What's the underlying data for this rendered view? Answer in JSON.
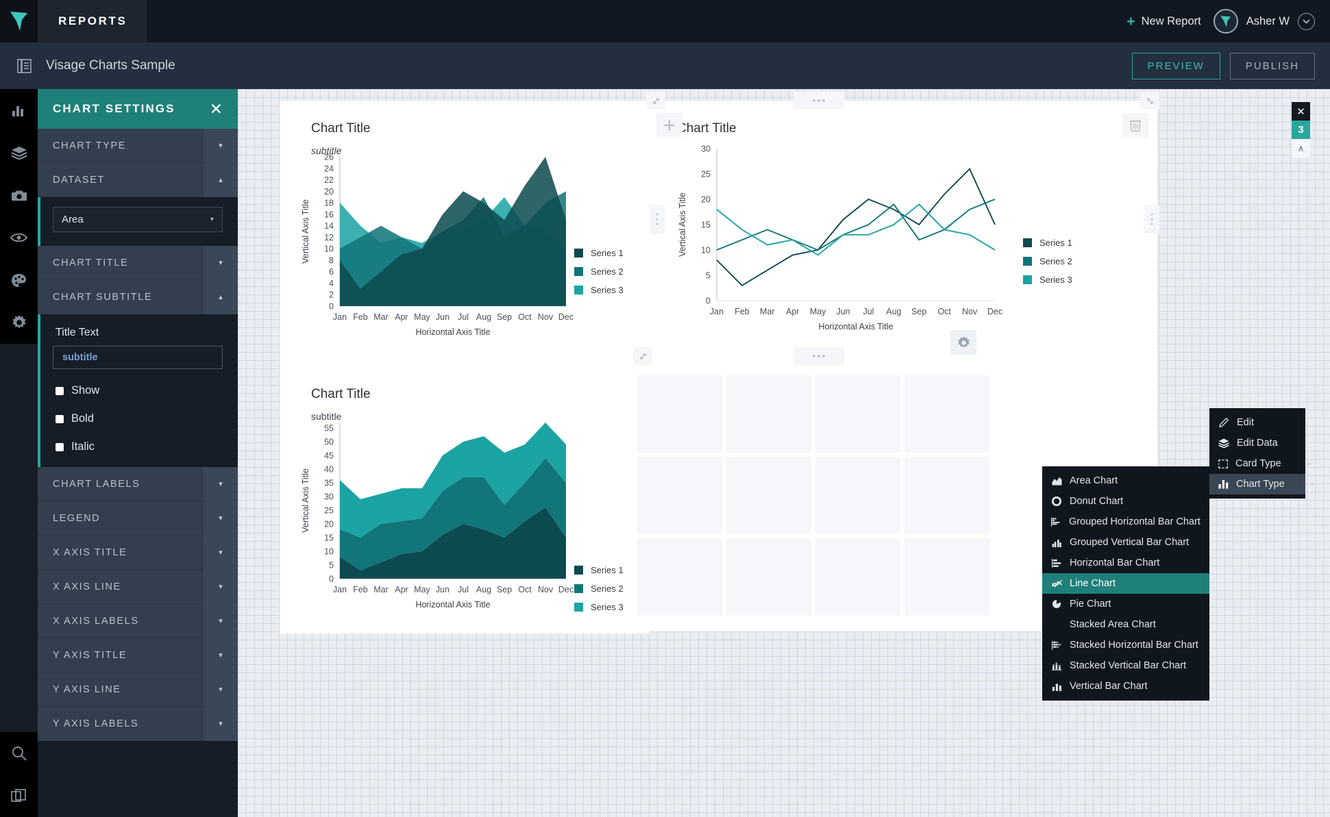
{
  "topbar": {
    "nav_tab": "REPORTS",
    "new_report": "New Report",
    "plus": "+",
    "user_name": "Asher W",
    "chevron": "⌄"
  },
  "subbar": {
    "doc_title": "Visage Charts Sample",
    "preview": "PREVIEW",
    "publish": "PUBLISH"
  },
  "rail": {
    "items": [
      {
        "icon": "bar-chart-icon"
      },
      {
        "icon": "layers-icon"
      },
      {
        "icon": "camera-icon"
      },
      {
        "icon": "eye-icon"
      },
      {
        "icon": "palette-icon"
      },
      {
        "icon": "gear-icon"
      }
    ],
    "bottom": [
      {
        "icon": "search-icon"
      },
      {
        "icon": "copy-icon"
      }
    ]
  },
  "panel": {
    "title": "CHART SETTINGS",
    "close": "✕",
    "sections": [
      {
        "label": "CHART TYPE",
        "open": false
      },
      {
        "label": "DATASET",
        "open": true
      },
      {
        "label": "CHART TITLE",
        "open": false
      },
      {
        "label": "CHART SUBTITLE",
        "open": true
      },
      {
        "label": "CHART LABELS",
        "open": false
      },
      {
        "label": "LEGEND",
        "open": false
      },
      {
        "label": "X AXIS TITLE",
        "open": false
      },
      {
        "label": "X AXIS LINE",
        "open": false
      },
      {
        "label": "X AXIS LABELS",
        "open": false
      },
      {
        "label": "Y AXIS TITLE",
        "open": false
      },
      {
        "label": "Y AXIS LINE",
        "open": false
      },
      {
        "label": "Y AXIS LABELS",
        "open": false
      }
    ],
    "dataset_value": "Area",
    "subtitle_field_label": "Title Text",
    "subtitle_value": "subtitle",
    "checkboxes": [
      {
        "label": "Show"
      },
      {
        "label": "Bold"
      },
      {
        "label": "Italic"
      }
    ],
    "caret_down": "▾",
    "caret_up": "▴",
    "select_tri": "▾"
  },
  "right_tabs": {
    "close": "✕",
    "count": "3",
    "collapse": "∧"
  },
  "card_menu": {
    "items": [
      {
        "label": "Edit",
        "icon": "pencil-icon",
        "arrow": false,
        "state": "normal"
      },
      {
        "label": "Edit Data",
        "icon": "layers-icon",
        "arrow": false,
        "state": "normal"
      },
      {
        "label": "Card Type",
        "icon": "card-icon",
        "arrow": true,
        "state": "normal"
      },
      {
        "label": "Chart Type",
        "icon": "bar-chart-icon",
        "arrow": true,
        "state": "selected"
      }
    ],
    "arrow_glyph": "▸"
  },
  "chart_type_menu": {
    "items": [
      {
        "label": "Area Chart",
        "icon": "area-chart-icon",
        "active": false
      },
      {
        "label": "Donut Chart",
        "icon": "donut-chart-icon",
        "active": false
      },
      {
        "label": "Grouped Horizontal Bar Chart",
        "icon": "grouped-h-bar-icon",
        "active": false
      },
      {
        "label": "Grouped Vertical Bar Chart",
        "icon": "grouped-v-bar-icon",
        "active": false
      },
      {
        "label": "Horizontal Bar Chart",
        "icon": "h-bar-icon",
        "active": false
      },
      {
        "label": "Line Chart",
        "icon": "line-chart-icon",
        "active": true
      },
      {
        "label": "Pie Chart",
        "icon": "pie-chart-icon",
        "active": false
      },
      {
        "label": "Stacked Area Chart",
        "icon": "none",
        "active": false
      },
      {
        "label": "Stacked Horizontal Bar Chart",
        "icon": "stacked-h-bar-icon",
        "active": false
      },
      {
        "label": "Stacked Vertical Bar Chart",
        "icon": "stacked-v-bar-icon",
        "active": false
      },
      {
        "label": "Vertical Bar Chart",
        "icon": "v-bar-icon",
        "active": false
      }
    ]
  },
  "colors": {
    "series1": "#0d4a4f",
    "series2": "#12757a",
    "series3": "#1ca3a3",
    "accent": "#2aa79c",
    "brand_teal": "#3fc7bd",
    "panel_header": "#1f8079"
  },
  "chart_data": [
    {
      "type": "area",
      "title": "Chart Title",
      "subtitle": "subtitle",
      "xlabel": "Horizontal Axis Title",
      "ylabel": "Vertical Axis Title",
      "categories": [
        "Jan",
        "Feb",
        "Mar",
        "Apr",
        "May",
        "Jun",
        "Jul",
        "Aug",
        "Sep",
        "Oct",
        "Nov",
        "Dec"
      ],
      "yticks": [
        0,
        2,
        4,
        6,
        8,
        10,
        12,
        14,
        16,
        18,
        20,
        22,
        24,
        26
      ],
      "ylim": [
        0,
        26
      ],
      "grid": false,
      "legend_position": "right",
      "series": [
        {
          "name": "Series 1",
          "values": [
            8,
            3,
            6,
            9,
            10,
            16,
            20,
            18,
            15,
            21,
            26,
            15
          ]
        },
        {
          "name": "Series 2",
          "values": [
            10,
            12,
            14,
            12,
            10,
            13,
            15,
            19,
            12,
            14,
            18,
            20
          ]
        },
        {
          "name": "Series 3",
          "values": [
            18,
            14,
            11,
            12,
            11,
            13,
            13,
            15,
            19,
            14,
            13,
            10
          ]
        }
      ]
    },
    {
      "type": "line",
      "title": "Chart Title",
      "subtitle": "",
      "xlabel": "Horizontal Axis Title",
      "ylabel": "Vertical Axis Title",
      "categories": [
        "Jan",
        "Feb",
        "Mar",
        "Apr",
        "May",
        "Jun",
        "Jul",
        "Aug",
        "Sep",
        "Oct",
        "Nov",
        "Dec"
      ],
      "yticks": [
        0,
        5,
        10,
        15,
        20,
        25,
        30
      ],
      "ylim": [
        0,
        30
      ],
      "grid": false,
      "legend_position": "right",
      "series": [
        {
          "name": "Series 1",
          "values": [
            8,
            3,
            6,
            9,
            10,
            16,
            20,
            18,
            15,
            21,
            26,
            15
          ]
        },
        {
          "name": "Series 2",
          "values": [
            10,
            12,
            14,
            12,
            10,
            13,
            15,
            19,
            12,
            14,
            18,
            20
          ]
        },
        {
          "name": "Series 3",
          "values": [
            18,
            14,
            11,
            12,
            9,
            13,
            13,
            15,
            19,
            14,
            13,
            10
          ]
        }
      ]
    },
    {
      "type": "area",
      "stacked": true,
      "title": "Chart Title",
      "subtitle": "subtitle",
      "xlabel": "Horizontal Axis Title",
      "ylabel": "Vertical Axis Title",
      "categories": [
        "Jan",
        "Feb",
        "Mar",
        "Apr",
        "May",
        "Jun",
        "Jul",
        "Aug",
        "Sep",
        "Oct",
        "Nov",
        "Dec"
      ],
      "yticks": [
        0,
        5,
        10,
        15,
        20,
        25,
        30,
        35,
        40,
        45,
        50,
        55
      ],
      "ylim": [
        0,
        57
      ],
      "grid": false,
      "legend_position": "right",
      "series": [
        {
          "name": "Series 1",
          "values": [
            8,
            3,
            6,
            9,
            10,
            16,
            20,
            18,
            15,
            21,
            26,
            15
          ]
        },
        {
          "name": "Series 2",
          "values": [
            10,
            12,
            14,
            12,
            12,
            16,
            17,
            19,
            12,
            14,
            18,
            20
          ]
        },
        {
          "name": "Series 3",
          "values": [
            18,
            14,
            11,
            12,
            11,
            13,
            13,
            15,
            19,
            14,
            13,
            14
          ]
        }
      ]
    }
  ]
}
